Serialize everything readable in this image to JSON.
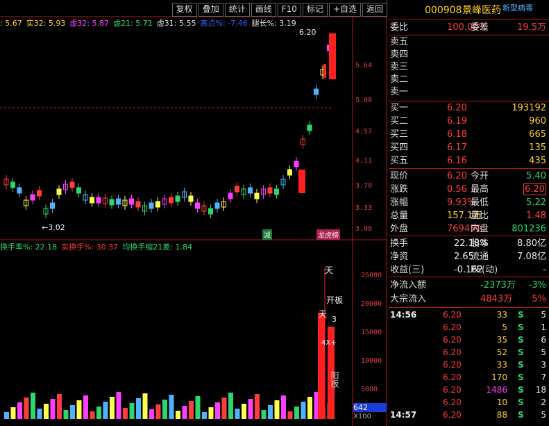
{
  "toolbar": [
    "复权",
    "叠加",
    "统计",
    "画线",
    "F10",
    "标记",
    "+自选",
    "返回"
  ],
  "indicators": [
    {
      "text": ": 5.67",
      "color": "#ffd21e"
    },
    {
      "text": "实32: 5.93",
      "color": "#ffd21e"
    },
    {
      "text": "虚32: 5.87",
      "color": "#ff3cff"
    },
    {
      "text": "虚21: 5.71",
      "color": "#2dd66b"
    },
    {
      "text": "虚31: 5.55",
      "color": "#dddddd"
    },
    {
      "text": "高点%: -7.46",
      "color": "#3c5cff"
    },
    {
      "text": "腿长%: 3.19",
      "color": "#dddddd"
    }
  ],
  "price_axis": [
    "5.64",
    "5.08",
    "4.57",
    "4.11",
    "3.70",
    "3.33",
    "3.00"
  ],
  "chart_labels": {
    "high": "6.20",
    "low": "3.02",
    "mark1": "减",
    "mark2": "龙虎榜"
  },
  "sub_indicator": [
    {
      "text": "换手率%: 22.18",
      "color": "#2dd66b"
    },
    {
      "text": "实换手%: 30.37",
      "color": "#ff3c3c"
    },
    {
      "text": "均换手缩21差: 1.84",
      "color": "#2dd66b"
    }
  ],
  "volume_axis": [
    "25000",
    "20000",
    "15000",
    "10000",
    "5000"
  ],
  "volume_box": {
    "value": "642",
    "unit": "X100"
  },
  "volume_marks": {
    "tian1": "天",
    "tian2": "天",
    "kaiban": "开板",
    "three": "3",
    "fourx": "4X+",
    "zhangting": "阳板"
  },
  "stock": {
    "code": "000908",
    "name": "景峰医药",
    "tag": "新型病毒"
  },
  "weibi": {
    "label": "委比",
    "value": "100.00%",
    "label2": "委差",
    "value2": "19.5万"
  },
  "asks": [
    "卖五",
    "卖四",
    "卖三",
    "卖二",
    "卖一"
  ],
  "bids": [
    {
      "label": "买一",
      "price": "6.20",
      "vol": "193192"
    },
    {
      "label": "买二",
      "price": "6.19",
      "vol": "960"
    },
    {
      "label": "买三",
      "price": "6.18",
      "vol": "665"
    },
    {
      "label": "买四",
      "price": "6.17",
      "vol": "135"
    },
    {
      "label": "买五",
      "price": "6.16",
      "vol": "435"
    }
  ],
  "quote": [
    {
      "l1": "现价",
      "v1": "6.20",
      "c1": "red",
      "l2": "今开",
      "v2": "5.40",
      "c2": "green"
    },
    {
      "l1": "涨跌",
      "v1": "0.56",
      "c1": "red",
      "l2": "最高",
      "v2": "6.20",
      "c2": "red",
      "box": true
    },
    {
      "l1": "涨幅",
      "v1": "9.93%",
      "c1": "red",
      "l2": "最低",
      "v2": "5.22",
      "c2": "green"
    },
    {
      "l1": "总量",
      "v1": "157.1万",
      "c1": "yellow",
      "l2": "量比",
      "v2": "1.48",
      "c2": "red"
    },
    {
      "l1": "外盘",
      "v1": "769450",
      "c1": "red",
      "l2": "内盘",
      "v2": "801236",
      "c2": "green"
    }
  ],
  "fund": [
    {
      "l1": "换手",
      "v1": "22.18%",
      "l2": "股本",
      "v2": "8.80亿"
    },
    {
      "l1": "净资",
      "v1": "2.65",
      "l2": "流通",
      "v2": "7.08亿"
    },
    {
      "l1": "收益(三)",
      "v1": "-0.162",
      "l2": "PE(动)",
      "v2": "-"
    }
  ],
  "flow": [
    {
      "label": "净流入额",
      "value": "-2373万",
      "pct": "-3%",
      "color": "green"
    },
    {
      "label": "大宗流入",
      "value": "4843万",
      "pct": "5%",
      "color": "red"
    }
  ],
  "trades": [
    {
      "time": "14:56",
      "price": "6.20",
      "vol": "33",
      "vc": "yellow",
      "side": "S",
      "n": "5"
    },
    {
      "time": "",
      "price": "6.20",
      "vol": "5",
      "vc": "yellow",
      "side": "S",
      "n": "1"
    },
    {
      "time": "",
      "price": "6.20",
      "vol": "35",
      "vc": "yellow",
      "side": "S",
      "n": "6"
    },
    {
      "time": "",
      "price": "6.20",
      "vol": "52",
      "vc": "yellow",
      "side": "S",
      "n": "5"
    },
    {
      "time": "",
      "price": "6.20",
      "vol": "33",
      "vc": "yellow",
      "side": "S",
      "n": "3"
    },
    {
      "time": "",
      "price": "6.20",
      "vol": "170",
      "vc": "yellow",
      "side": "S",
      "n": "7"
    },
    {
      "time": "",
      "price": "6.20",
      "vol": "1486",
      "vc": "magenta",
      "side": "S",
      "n": "18"
    },
    {
      "time": "",
      "price": "6.20",
      "vol": "10",
      "vc": "yellow",
      "side": "S",
      "n": "2"
    },
    {
      "time": "14:57",
      "price": "6.20",
      "vol": "88",
      "vc": "yellow",
      "side": "S",
      "n": "5"
    }
  ]
}
